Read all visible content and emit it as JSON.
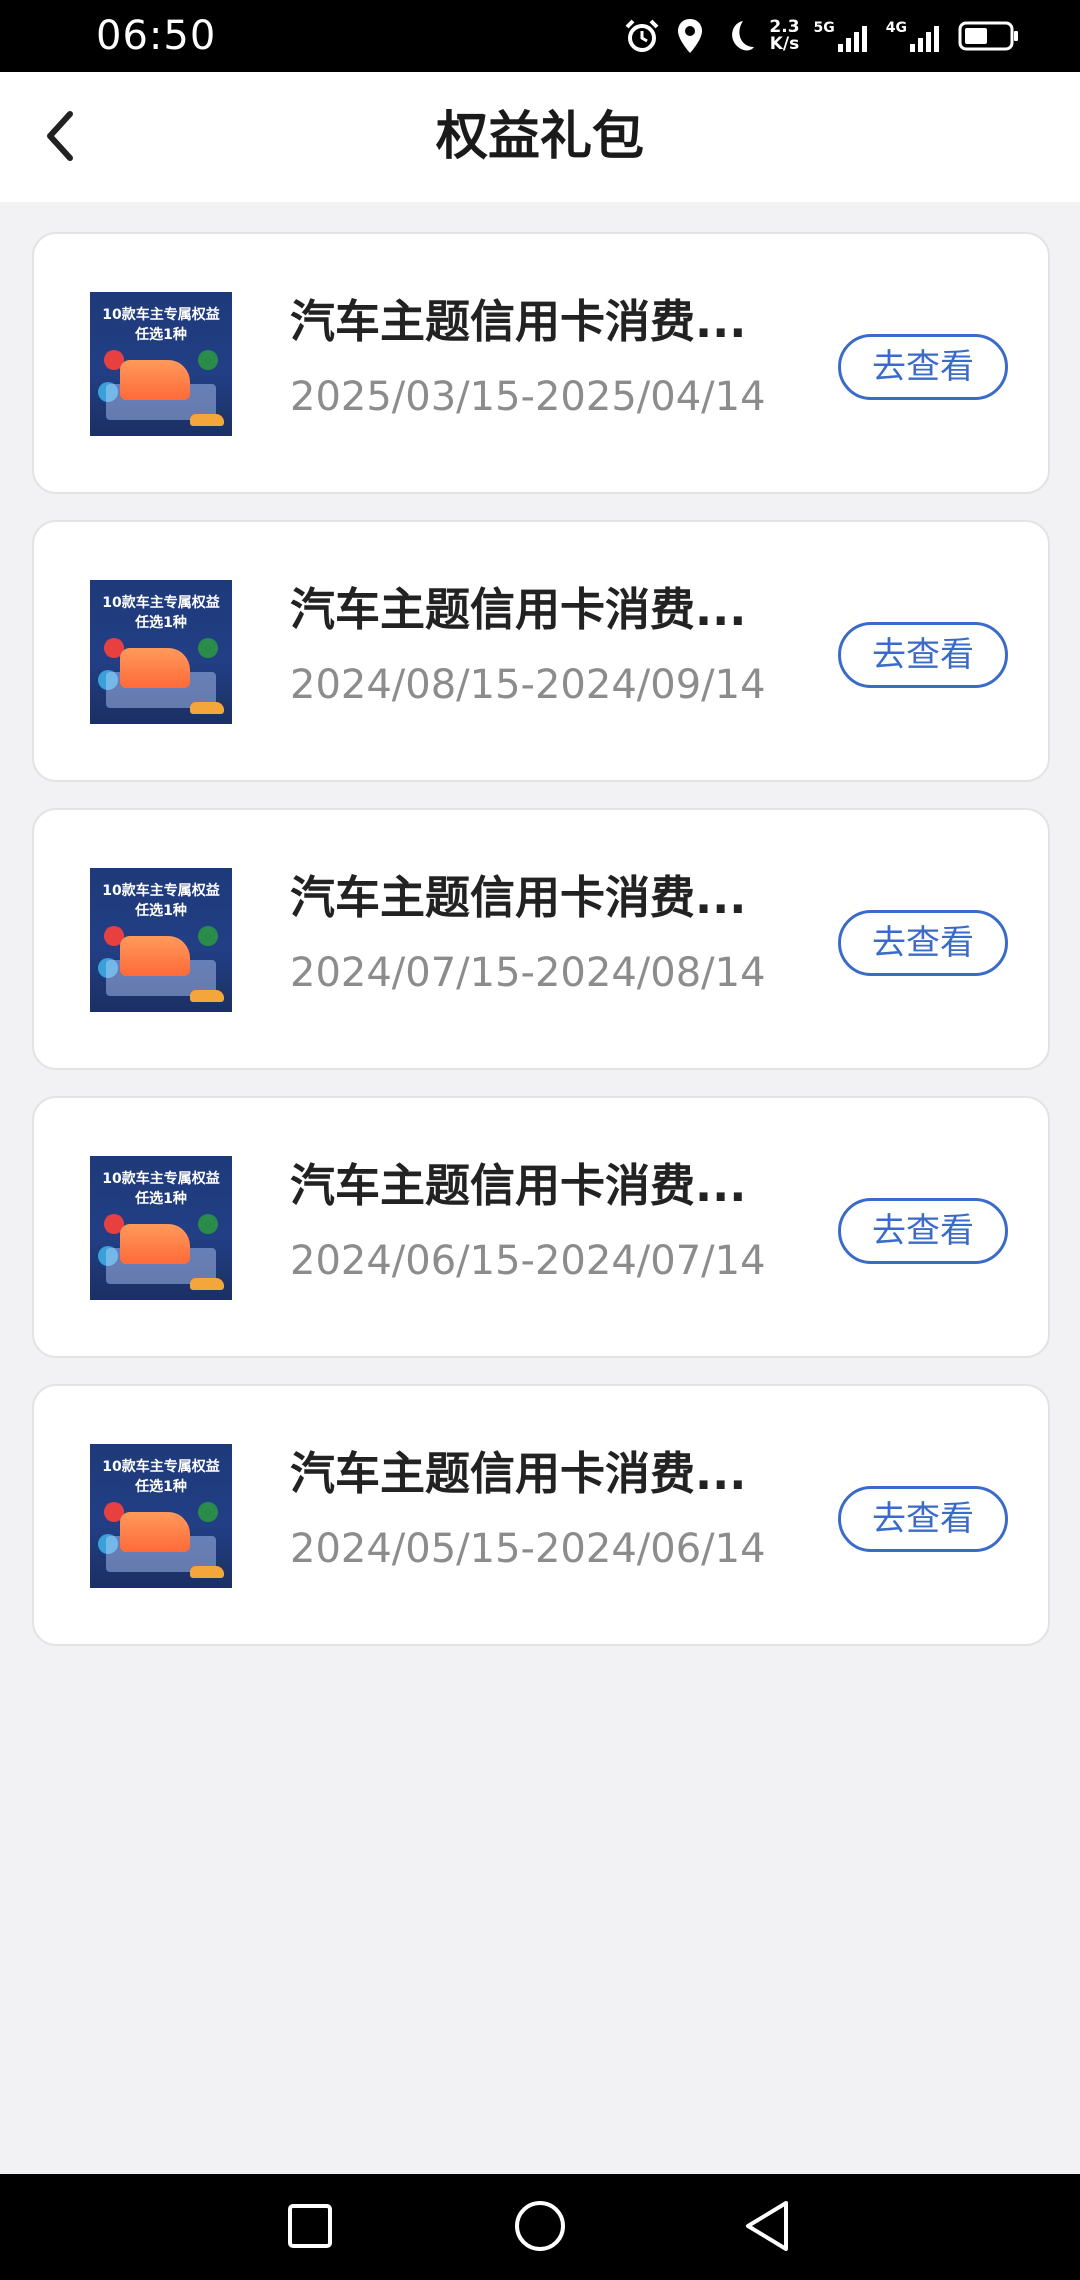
{
  "status_bar": {
    "time": "06:50",
    "net_speed_value": "2.3",
    "net_speed_unit": "K/s",
    "network_1": "5G",
    "network_2": "4G"
  },
  "header": {
    "title": "权益礼包"
  },
  "thumbnail": {
    "line1": "10款车主专属权益",
    "line2": "任选1种"
  },
  "items": [
    {
      "title": "汽车主题信用卡消费...",
      "date_range": "2025/03/15-2025/04/14",
      "button": "去查看"
    },
    {
      "title": "汽车主题信用卡消费...",
      "date_range": "2024/08/15-2024/09/14",
      "button": "去查看"
    },
    {
      "title": "汽车主题信用卡消费...",
      "date_range": "2024/07/15-2024/08/14",
      "button": "去查看"
    },
    {
      "title": "汽车主题信用卡消费...",
      "date_range": "2024/06/15-2024/07/14",
      "button": "去查看"
    },
    {
      "title": "汽车主题信用卡消费...",
      "date_range": "2024/05/15-2024/06/14",
      "button": "去查看"
    }
  ],
  "colors": {
    "accent": "#3a6bc9",
    "background": "#f2f2f4",
    "card": "#ffffff",
    "date_text": "#8c8c8c"
  }
}
